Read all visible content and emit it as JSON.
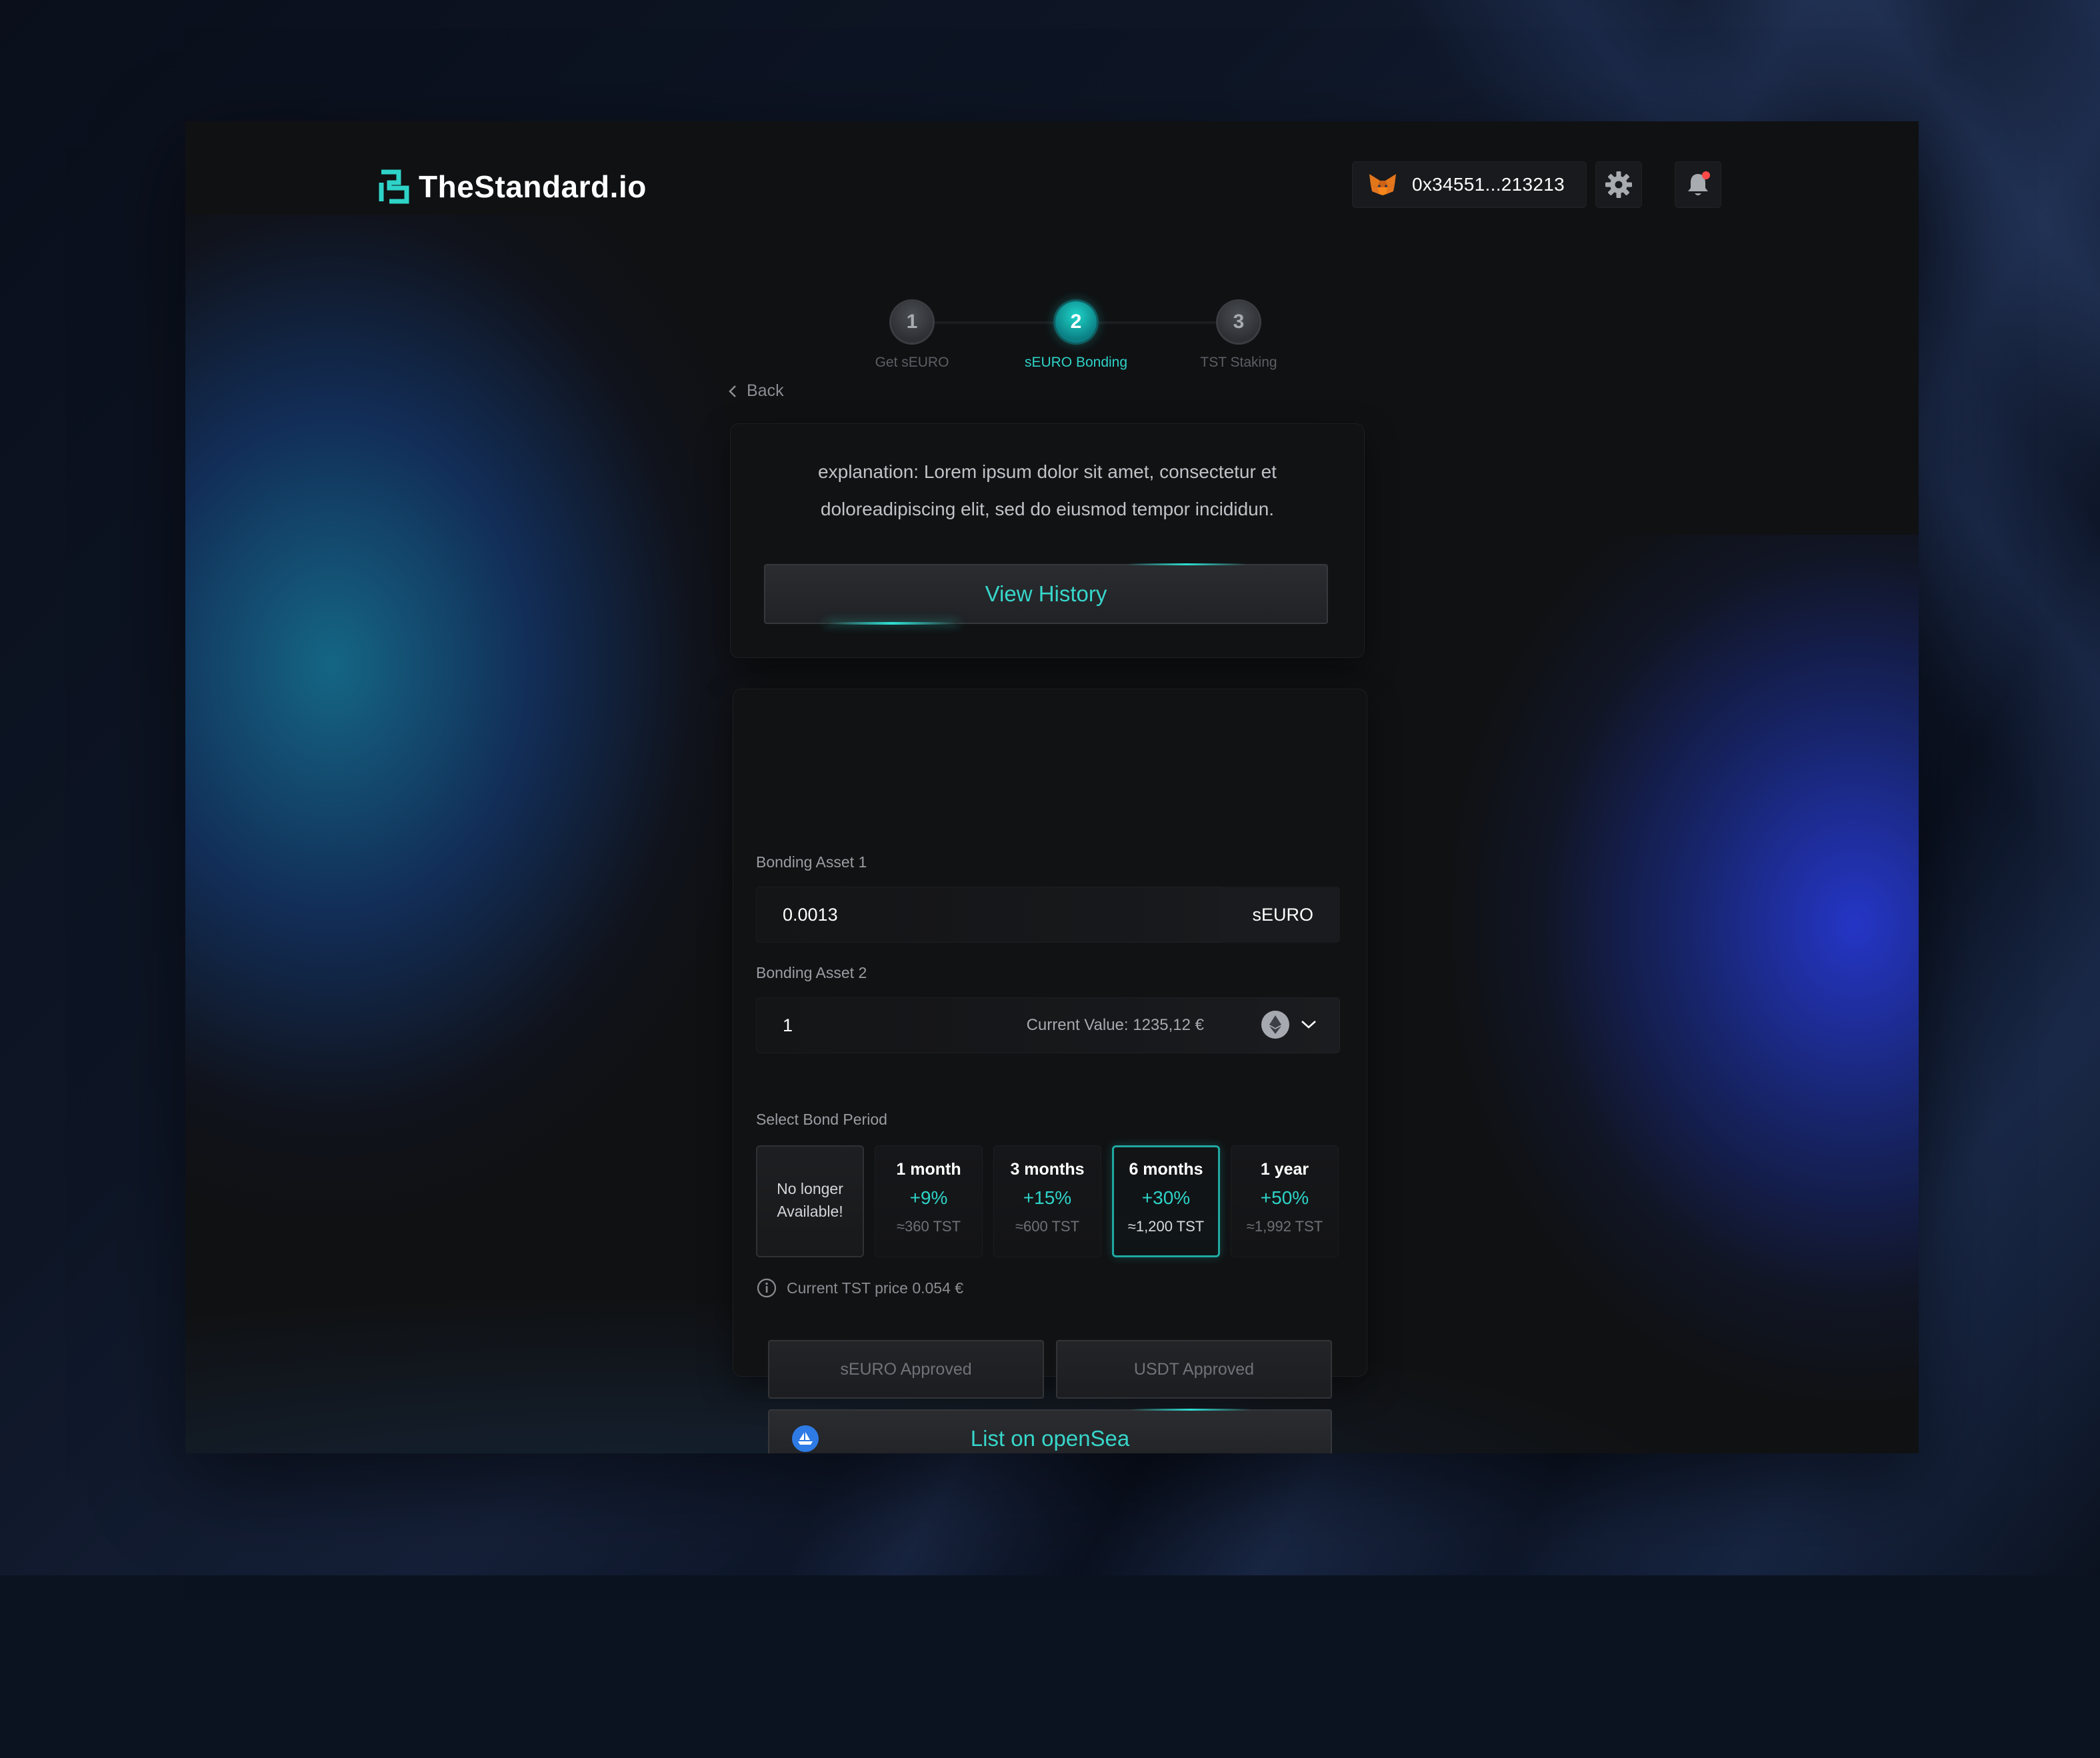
{
  "header": {
    "brand": "TheStandard.io",
    "wallet_address": "0x34551...213213",
    "icons": [
      "metamask-fox-icon",
      "gear-icon",
      "bell-icon"
    ],
    "notification_dot_color": "#ff4a4a"
  },
  "stepper": {
    "steps": [
      {
        "number": "1",
        "label": "Get sEURO",
        "state": "done"
      },
      {
        "number": "2",
        "label": "sEURO Bonding",
        "state": "active"
      },
      {
        "number": "3",
        "label": "TST Staking",
        "state": "pending"
      }
    ]
  },
  "nav": {
    "back_label": "Back"
  },
  "explanation": {
    "text": "explanation: Lorem ipsum dolor sit amet, consectetur et doloreadipiscing elit, sed do eiusmod tempor incididun.",
    "view_history_label": "View History"
  },
  "bonding": {
    "asset1": {
      "label": "Bonding Asset 1",
      "value": "0.0013",
      "unit": "sEURO"
    },
    "asset2": {
      "label": "Bonding Asset 2",
      "value": "1",
      "current_value": "Current Value: 1235,12 €",
      "icon": "ethereum-icon"
    },
    "period_label": "Select Bond Period",
    "unavailable_label": "No longer Available!",
    "periods": [
      {
        "name": "1 month",
        "rate": "+9%",
        "tst": "≈360 TST"
      },
      {
        "name": "3 months",
        "rate": "+15%",
        "tst": "≈600 TST"
      },
      {
        "name": "6 months",
        "rate": "+30%",
        "tst": "≈1,200 TST"
      },
      {
        "name": "1 year",
        "rate": "+50%",
        "tst": "≈1,992 TST"
      }
    ],
    "selected_period": "6 months",
    "tst_price": "Current TST price 0.054 €",
    "seuro_approved_label": "sEURO Approved",
    "usdt_approved_label": "USDT Approved",
    "list_opensea_label": "List on openSea"
  },
  "colors": {
    "accent": "#2ed3c8",
    "background": "#101113",
    "card": "#111214",
    "text_primary": "#ffffff",
    "text_muted": "#9a9da2"
  }
}
